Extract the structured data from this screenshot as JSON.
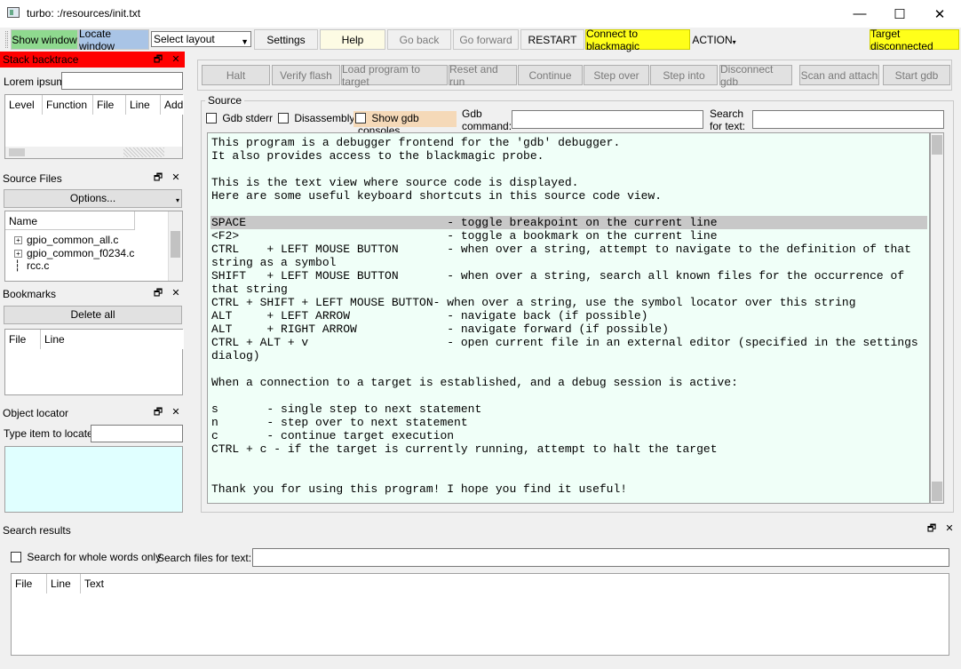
{
  "window": {
    "title": "turbo: :/resources/init.txt",
    "min": "—",
    "max": "☐",
    "close": "✕"
  },
  "toolbar": {
    "show_window": "Show window",
    "locate_window": "Locate window",
    "layout_select": "Select layout",
    "settings": "Settings",
    "help": "Help",
    "go_back": "Go back",
    "go_forward": "Go forward",
    "restart": "RESTART",
    "connect": "Connect to blackmagic",
    "action": "ACTION",
    "target_status": "Target disconnected"
  },
  "stack": {
    "title": "Stack backtrace",
    "lorem": "Lorem ipsum",
    "columns": [
      "Level",
      "Function",
      "File",
      "Line",
      "Add"
    ]
  },
  "source_files": {
    "title": "Source Files",
    "options": "Options...",
    "col_name": "Name",
    "items": [
      "gpio_common_all.c",
      "gpio_common_f0234.c",
      "rcc.c"
    ]
  },
  "bookmarks": {
    "title": "Bookmarks",
    "delete_all": "Delete all",
    "columns": [
      "File",
      "Line"
    ]
  },
  "locator": {
    "title": "Object locator",
    "label": "Type item to locate"
  },
  "debug_buttons": [
    "Halt",
    "Verify flash",
    "Load program to target",
    "Reset and run",
    "Continue",
    "Step over",
    "Step into",
    "Disconnect gdb",
    "Scan and attach",
    "Start gdb"
  ],
  "source": {
    "group_title": "Source",
    "gdb_stderr": "Gdb stderr",
    "disassembly": "Disassembly",
    "show_consoles": "Show gdb consoles",
    "gdb_cmd_1": "Gdb",
    "gdb_cmd_2": "command:",
    "search_1": "Search",
    "search_2": "for text:",
    "lines": [
      "This program is a debugger frontend for the 'gdb' debugger.",
      "It also provides access to the blackmagic probe.",
      "",
      "This is the text view where source code is displayed.",
      "Here are some useful keyboard shortcuts in this source code view.",
      "",
      "SPACE                             - toggle breakpoint on the current line",
      "<F2>                              - toggle a bookmark on the current line",
      "CTRL    + LEFT MOUSE BUTTON       - when over a string, attempt to navigate to the definition of that",
      "string as a symbol",
      "SHIFT   + LEFT MOUSE BUTTON       - when over a string, search all known files for the occurrence of",
      "that string",
      "CTRL + SHIFT + LEFT MOUSE BUTTON- when over a string, use the symbol locator over this string",
      "ALT     + LEFT ARROW              - navigate back (if possible)",
      "ALT     + RIGHT ARROW             - navigate forward (if possible)",
      "CTRL + ALT + v                    - open current file in an external editor (specified in the settings",
      "dialog)",
      "",
      "When a connection to a target is established, and a debug session is active:",
      "",
      "s       - single step to next statement",
      "n       - step over to next statement",
      "c       - continue target execution",
      "CTRL + c - if the target is currently running, attempt to halt the target",
      "",
      "",
      "Thank you for using this program! I hope you find it useful!"
    ]
  },
  "search_results": {
    "title": "Search results",
    "whole_words": "Search for whole words only",
    "search_files": "Search files for text:",
    "columns": [
      "File",
      "Line",
      "Text"
    ]
  }
}
